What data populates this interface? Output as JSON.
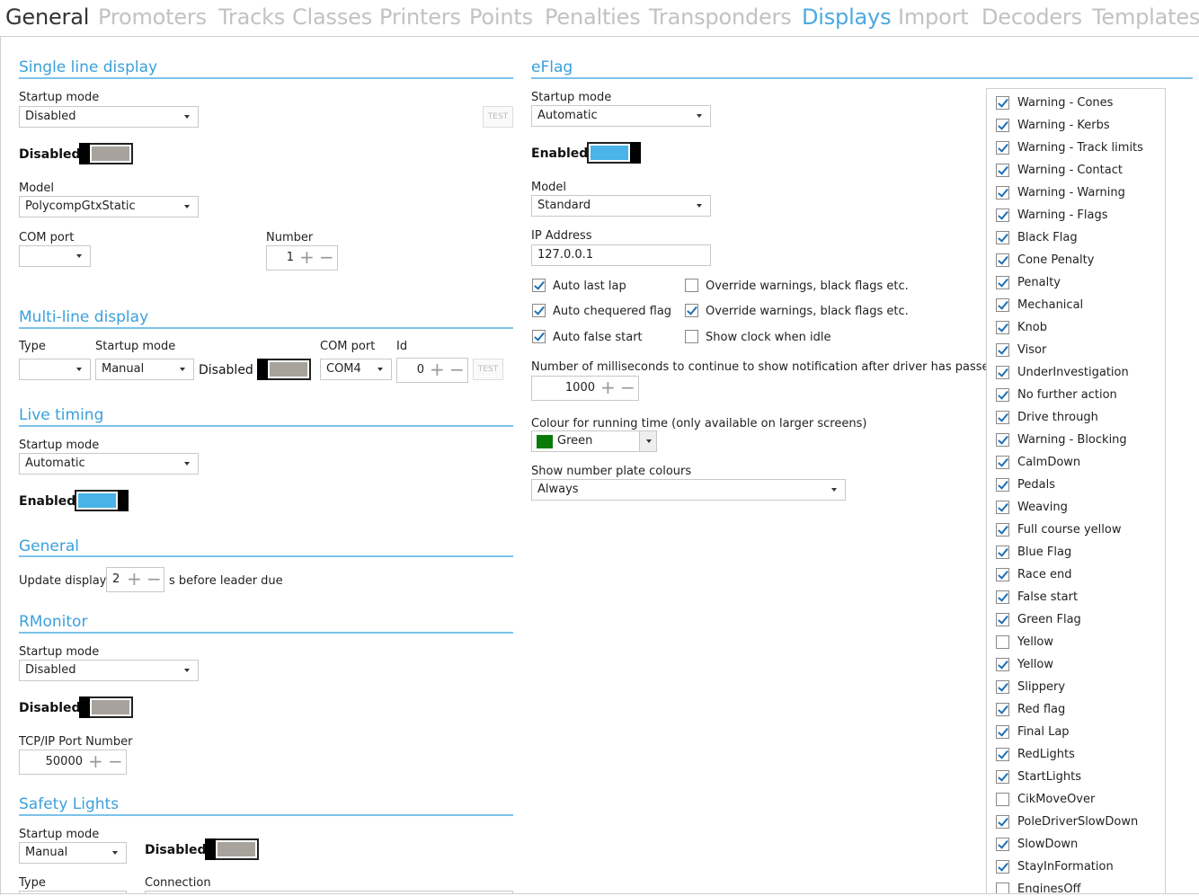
{
  "tabs": [
    "General",
    "Promoters",
    "Tracks",
    "Classes",
    "Printers",
    "Points",
    "Penalties",
    "Transponders",
    "Displays",
    "Import",
    "Decoders",
    "Templates"
  ],
  "active_tab": "Displays",
  "single_line": {
    "title": "Single line display",
    "startup_label": "Startup mode",
    "startup_value": "Disabled",
    "test_label": "TEST",
    "state_label": "Disabled",
    "state_on": false,
    "model_label": "Model",
    "model_value": "PolycompGtxStatic",
    "com_label": "COM port",
    "com_value": "",
    "number_label": "Number",
    "number_value": "1"
  },
  "multi_line": {
    "title": "Multi-line display",
    "type_label": "Type",
    "type_value": "",
    "startup_label": "Startup mode",
    "startup_value": "Manual",
    "state_label": "Disabled",
    "state_on": false,
    "com_label": "COM port",
    "com_value": "COM4",
    "id_label": "Id",
    "id_value": "0",
    "test_label": "TEST"
  },
  "live_timing": {
    "title": "Live timing",
    "startup_label": "Startup mode",
    "startup_value": "Automatic",
    "state_label": "Enabled",
    "state_on": true
  },
  "general": {
    "title": "General",
    "update_label": "Update display",
    "update_value": "2",
    "suffix": "s before leader due"
  },
  "rmonitor": {
    "title": "RMonitor",
    "startup_label": "Startup mode",
    "startup_value": "Disabled",
    "state_label": "Disabled",
    "state_on": false,
    "port_label": "TCP/IP Port Number",
    "port_value": "50000"
  },
  "safety_lights": {
    "title": "Safety Lights",
    "startup_label": "Startup mode",
    "startup_value": "Manual",
    "state_label": "Disabled",
    "state_on": false,
    "type_label": "Type",
    "connection_label": "Connection"
  },
  "eflag": {
    "title": "eFlag",
    "startup_label": "Startup mode",
    "startup_value": "Automatic",
    "state_label": "Enabled",
    "state_on": true,
    "model_label": "Model",
    "model_value": "Standard",
    "ip_label": "IP Address",
    "ip_value": "127.0.0.1",
    "options": [
      {
        "label": "Auto last lap",
        "checked": true
      },
      {
        "label": "Override warnings, black flags etc.",
        "checked": false
      },
      {
        "label": "Auto chequered flag",
        "checked": true
      },
      {
        "label": "Override warnings, black flags etc.",
        "checked": true
      },
      {
        "label": "Auto false start",
        "checked": true
      },
      {
        "label": "Show clock when idle",
        "checked": false
      }
    ],
    "ms_label": "Number of milliseconds to continue to show notification after driver has passed",
    "ms_value": "1000",
    "colour_label": "Colour for running time (only available on larger screens)",
    "colour_value": "Green",
    "colour_hex": "#0a7a0a",
    "plate_label": "Show number plate colours",
    "plate_value": "Always"
  },
  "flags": [
    {
      "label": "Warning - Cones",
      "checked": true
    },
    {
      "label": "Warning - Kerbs",
      "checked": true
    },
    {
      "label": "Warning - Track limits",
      "checked": true
    },
    {
      "label": "Warning - Contact",
      "checked": true
    },
    {
      "label": "Warning - Warning",
      "checked": true
    },
    {
      "label": "Warning - Flags",
      "checked": true
    },
    {
      "label": "Black Flag",
      "checked": true
    },
    {
      "label": "Cone Penalty",
      "checked": true
    },
    {
      "label": "Penalty",
      "checked": true
    },
    {
      "label": "Mechanical",
      "checked": true
    },
    {
      "label": "Knob",
      "checked": true
    },
    {
      "label": "Visor",
      "checked": true
    },
    {
      "label": "UnderInvestigation",
      "checked": true
    },
    {
      "label": "No further action",
      "checked": true
    },
    {
      "label": "Drive through",
      "checked": true
    },
    {
      "label": "Warning - Blocking",
      "checked": true
    },
    {
      "label": "CalmDown",
      "checked": true
    },
    {
      "label": "Pedals",
      "checked": true
    },
    {
      "label": "Weaving",
      "checked": true
    },
    {
      "label": "Full course yellow",
      "checked": true
    },
    {
      "label": "Blue Flag",
      "checked": true
    },
    {
      "label": "Race end",
      "checked": true
    },
    {
      "label": "False start",
      "checked": true
    },
    {
      "label": "Green Flag",
      "checked": true
    },
    {
      "label": "Yellow",
      "checked": false
    },
    {
      "label": "Yellow",
      "checked": true
    },
    {
      "label": "Slippery",
      "checked": true
    },
    {
      "label": "Red flag",
      "checked": true
    },
    {
      "label": "Final Lap",
      "checked": true
    },
    {
      "label": "RedLights",
      "checked": true
    },
    {
      "label": "StartLights",
      "checked": true
    },
    {
      "label": "CikMoveOver",
      "checked": false
    },
    {
      "label": "PoleDriverSlowDown",
      "checked": true
    },
    {
      "label": "SlowDown",
      "checked": true
    },
    {
      "label": "StayInFormation",
      "checked": true
    },
    {
      "label": "EnginesOff",
      "checked": false
    }
  ],
  "colors": {
    "accent": "#3aa0dc",
    "toggle_on": "#4ab3e8",
    "toggle_off": "#a7a39c"
  }
}
